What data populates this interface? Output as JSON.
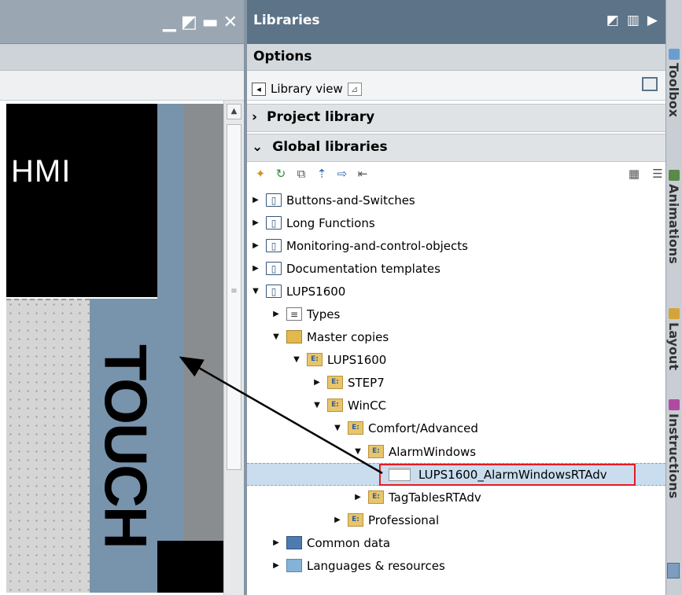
{
  "left_panel": {
    "hmi_label": "HMI",
    "touch_label": "TOUCH",
    "window_buttons": [
      "minimize-icon",
      "restore-icon",
      "maximize-icon",
      "close-icon"
    ]
  },
  "libraries": {
    "title": "Libraries",
    "options_label": "Options",
    "library_view_label": "Library view",
    "project_library_label": "Project library",
    "global_libraries_label": "Global libraries",
    "tree": [
      {
        "label": "Buttons-and-Switches",
        "icon": "book-icon"
      },
      {
        "label": "Long Functions",
        "icon": "book-icon"
      },
      {
        "label": "Monitoring-and-control-objects",
        "icon": "book-icon"
      },
      {
        "label": "Documentation templates",
        "icon": "book-icon"
      },
      {
        "label": "LUPS1600",
        "icon": "book-icon"
      },
      {
        "label": "Types",
        "icon": "types-icon"
      },
      {
        "label": "Master copies",
        "icon": "master-copies-icon"
      },
      {
        "label": "LUPS1600",
        "icon": "folder-icon"
      },
      {
        "label": "STEP7",
        "icon": "folder-icon"
      },
      {
        "label": "WinCC",
        "icon": "folder-icon"
      },
      {
        "label": "Comfort/Advanced",
        "icon": "folder-icon"
      },
      {
        "label": "AlarmWindows",
        "icon": "folder-icon"
      },
      {
        "label": "LUPS1600_AlarmWindowsRTAdv",
        "icon": "alarm-window-icon"
      },
      {
        "label": "TagTablesRTAdv",
        "icon": "folder-icon"
      },
      {
        "label": "Professional",
        "icon": "folder-icon"
      },
      {
        "label": "Common data",
        "icon": "common-data-icon"
      },
      {
        "label": "Languages & resources",
        "icon": "languages-icon"
      }
    ]
  },
  "right_tabs": [
    "Toolbox",
    "Animations",
    "Layout",
    "Instructions"
  ],
  "colors": {
    "title_bar": "#5d7387",
    "selection": "#c9ddef",
    "highlight_box": "#e31b23",
    "arrow": "#000000"
  }
}
